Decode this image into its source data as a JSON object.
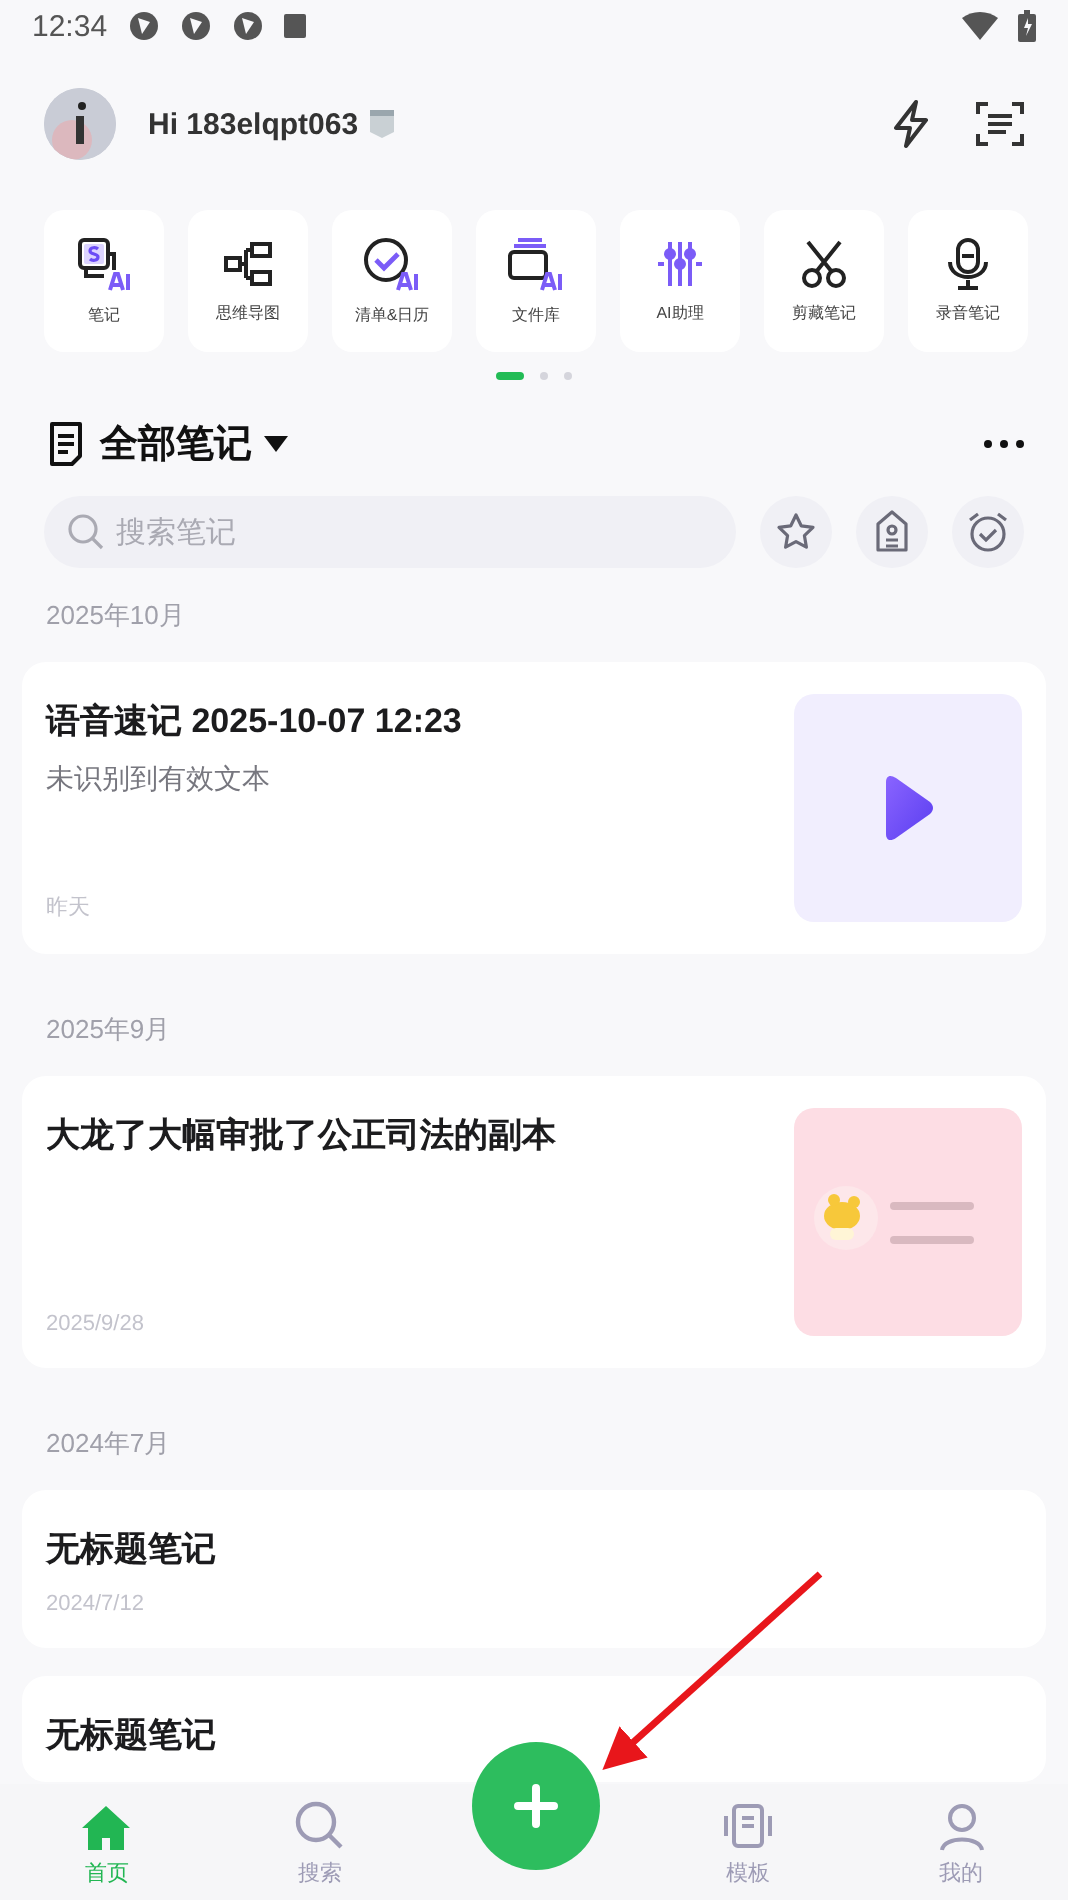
{
  "status_bar": {
    "time": "12:34"
  },
  "header": {
    "greeting": "Hi 183elqpt063"
  },
  "quick_tools": [
    {
      "label": "笔记",
      "kind": "note"
    },
    {
      "label": "思维导图",
      "kind": "mindmap"
    },
    {
      "label": "清单&日历",
      "kind": "todo"
    },
    {
      "label": "文件库",
      "kind": "files"
    },
    {
      "label": "AI助理",
      "kind": "assistant"
    },
    {
      "label": "剪藏笔记",
      "kind": "clip"
    },
    {
      "label": "录音笔记",
      "kind": "record"
    }
  ],
  "pager": [
    {
      "selected": true
    },
    {
      "selected": false
    },
    {
      "selected": false
    }
  ],
  "notes_header": {
    "title": "全部笔记"
  },
  "search": {
    "placeholder": "搜索笔记"
  },
  "sections": [
    {
      "label": "2025年10月",
      "notes": [
        {
          "title": "语音速记 2025-10-07 12:23",
          "snippet": "未识别到有效文本",
          "date": "昨天",
          "thumbnail": {
            "kind": "audio"
          }
        }
      ]
    },
    {
      "label": "2025年9月",
      "notes": [
        {
          "title": "大龙了大幅审批了公正司法的副本",
          "date": "2025/9/28"
        }
      ]
    },
    {
      "label": "2024年7月",
      "notes": [
        {
          "title": "无标题笔记",
          "date": "2024/7/12"
        },
        {
          "title": "无标题笔记"
        }
      ]
    }
  ],
  "bottom_nav": [
    {
      "kind": "home",
      "label": "首页",
      "selected": true
    },
    {
      "kind": "search",
      "label": "搜索",
      "selected": false
    },
    {
      "kind": "add"
    },
    {
      "kind": "template",
      "label": "模板",
      "selected": false
    },
    {
      "kind": "profile",
      "label": "我的",
      "selected": false
    }
  ],
  "annotation": {
    "kind": "arrow"
  }
}
